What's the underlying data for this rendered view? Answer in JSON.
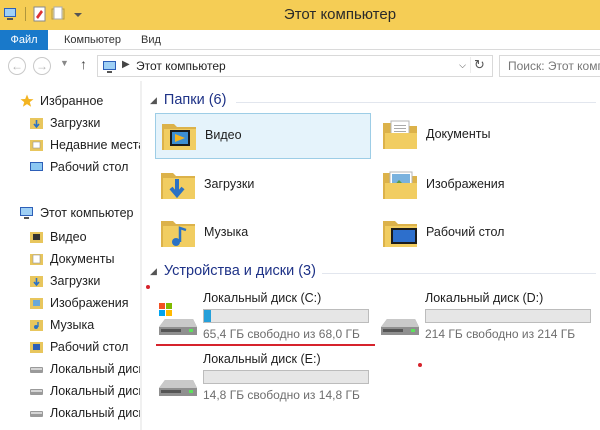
{
  "window": {
    "title": "Этот компьютер"
  },
  "ribbon": {
    "tabs": [
      "Файл",
      "Компьютер",
      "Вид"
    ]
  },
  "nav": {
    "back": "←",
    "forward": "→",
    "up": "↑",
    "breadcrumb": "Этот компьютер",
    "search_placeholder": "Поиск: Этот компьютер"
  },
  "sidebar": {
    "favorites": {
      "label": "Избранное",
      "items": [
        "Загрузки",
        "Недавние места",
        "Рабочий стол"
      ]
    },
    "computer": {
      "label": "Этот компьютер",
      "items": [
        "Видео",
        "Документы",
        "Загрузки",
        "Изображения",
        "Музыка",
        "Рабочий стол",
        "Локальный диск (C:)",
        "Локальный диск (D:)",
        "Локальный диск (E:)"
      ]
    }
  },
  "folders": {
    "header": "Папки (6)",
    "items": [
      {
        "name": "Видео",
        "icon": "video-folder-icon"
      },
      {
        "name": "Документы",
        "icon": "documents-folder-icon"
      },
      {
        "name": "Загрузки",
        "icon": "downloads-folder-icon"
      },
      {
        "name": "Изображения",
        "icon": "pictures-folder-icon"
      },
      {
        "name": "Музыка",
        "icon": "music-folder-icon"
      },
      {
        "name": "Рабочий стол",
        "icon": "desktop-folder-icon"
      }
    ]
  },
  "drives": {
    "header": "Устройства и диски (3)",
    "items": [
      {
        "name": "Локальный диск (C:)",
        "free_text": "65,4 ГБ свободно из 68,0 ГБ",
        "used_fraction": 0.04,
        "system": true
      },
      {
        "name": "Локальный диск (D:)",
        "free_text": "214 ГБ свободно из 214 ГБ",
        "used_fraction": 0.0,
        "system": false
      },
      {
        "name": "Локальный диск (E:)",
        "free_text": "14,8 ГБ свободно из 14,8 ГБ",
        "used_fraction": 0.0,
        "system": false
      }
    ]
  },
  "colors": {
    "titlebar": "#f5cd55",
    "file_tab": "#1979ca",
    "group_header": "#1e3287",
    "bar_fill": "#26a0da",
    "annotation": "#d6232c"
  }
}
